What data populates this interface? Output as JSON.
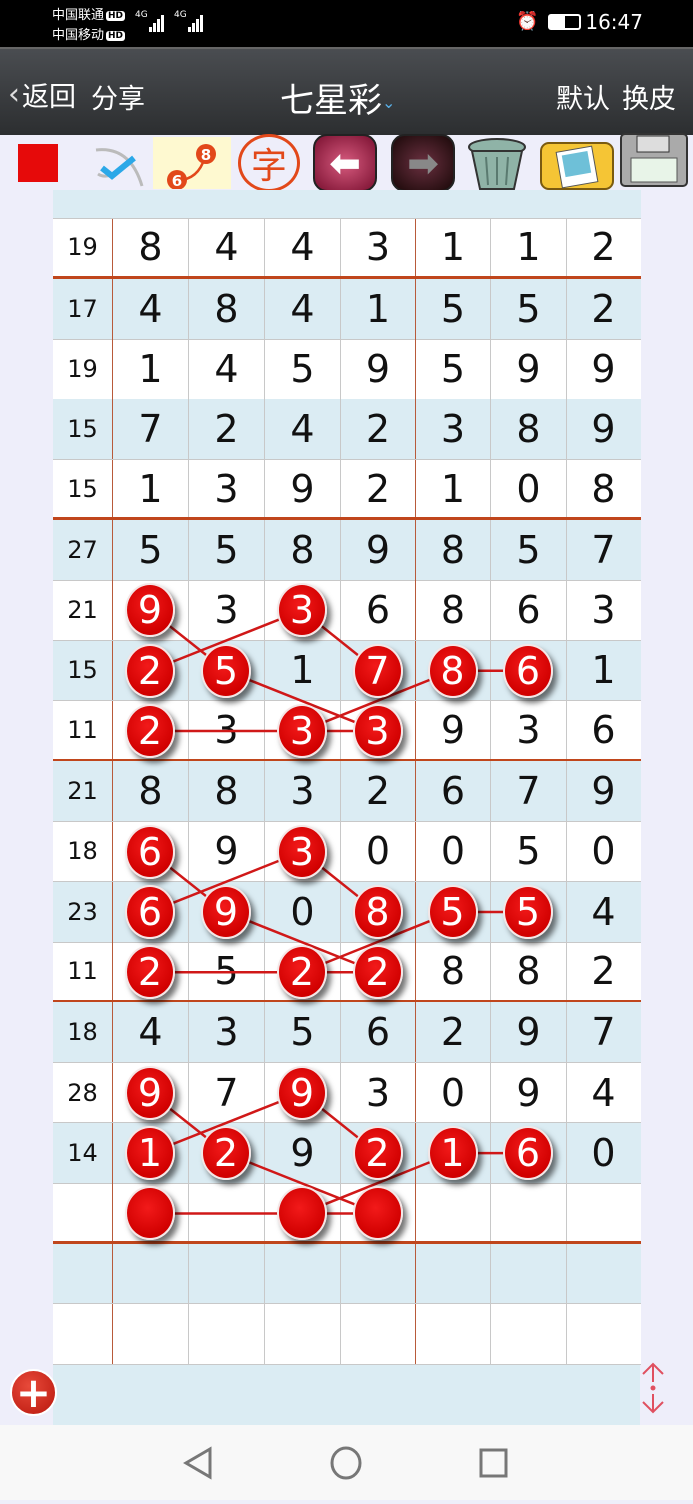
{
  "status_bar": {
    "carrier1": "中国联通",
    "carrier2": "中国移动",
    "hd": "HD",
    "net1": "4G",
    "net2": "4G",
    "time": "16:47",
    "battery_percent": 50
  },
  "header": {
    "back_label": "返回",
    "share_label": "分享",
    "title": "七星彩",
    "default_label": "默认",
    "skin_label": "换皮"
  },
  "toolbar": {
    "icons": [
      "red-square",
      "check-mark",
      "link-6-8",
      "zi-character",
      "arrow-left",
      "arrow-right",
      "trash",
      "photo-folder",
      "floppy-disk"
    ],
    "link_small": "6",
    "link_big": "8",
    "zi": "字",
    "selected_color": "#e60a0a"
  },
  "colors": {
    "ball": "#e00000",
    "row_alt": "#dbecf3",
    "group_line": "#c0461c"
  },
  "table": {
    "rows": [
      {
        "sum": "19",
        "nums": [
          "8",
          "4",
          "4",
          "3",
          "1",
          "1",
          "2"
        ]
      },
      {
        "sum": "17",
        "nums": [
          "4",
          "8",
          "4",
          "1",
          "5",
          "5",
          "2"
        ]
      },
      {
        "sum": "19",
        "nums": [
          "1",
          "4",
          "5",
          "9",
          "5",
          "9",
          "9"
        ]
      },
      {
        "sum": "15",
        "nums": [
          "7",
          "2",
          "4",
          "2",
          "3",
          "8",
          "9"
        ]
      },
      {
        "sum": "15",
        "nums": [
          "1",
          "3",
          "9",
          "2",
          "1",
          "0",
          "8"
        ]
      },
      {
        "sum": "27",
        "nums": [
          "5",
          "5",
          "8",
          "9",
          "8",
          "5",
          "7"
        ]
      },
      {
        "sum": "21",
        "nums": [
          "9",
          "3",
          "3",
          "6",
          "8",
          "6",
          "3"
        ],
        "balls": [
          0,
          2
        ]
      },
      {
        "sum": "15",
        "nums": [
          "2",
          "5",
          "1",
          "7",
          "8",
          "6",
          "1"
        ],
        "balls": [
          0,
          1,
          3,
          4,
          5
        ]
      },
      {
        "sum": "11",
        "nums": [
          "2",
          "3",
          "3",
          "3",
          "9",
          "3",
          "6"
        ],
        "balls": [
          0,
          2,
          3
        ]
      },
      {
        "sum": "21",
        "nums": [
          "8",
          "8",
          "3",
          "2",
          "6",
          "7",
          "9"
        ]
      },
      {
        "sum": "18",
        "nums": [
          "6",
          "9",
          "3",
          "0",
          "0",
          "5",
          "0"
        ],
        "balls": [
          0,
          2
        ]
      },
      {
        "sum": "23",
        "nums": [
          "6",
          "9",
          "0",
          "8",
          "5",
          "5",
          "4"
        ],
        "balls": [
          0,
          1,
          3,
          4,
          5
        ]
      },
      {
        "sum": "11",
        "nums": [
          "2",
          "5",
          "2",
          "2",
          "8",
          "8",
          "2"
        ],
        "balls": [
          0,
          2,
          3
        ]
      },
      {
        "sum": "18",
        "nums": [
          "4",
          "3",
          "5",
          "6",
          "2",
          "9",
          "7"
        ]
      },
      {
        "sum": "28",
        "nums": [
          "9",
          "7",
          "9",
          "3",
          "0",
          "9",
          "4"
        ],
        "balls": [
          0,
          2
        ]
      },
      {
        "sum": "14",
        "nums": [
          "1",
          "2",
          "9",
          "2",
          "1",
          "6",
          "0"
        ],
        "balls": [
          0,
          1,
          3,
          4,
          5
        ]
      },
      {
        "sum": "",
        "nums": [
          "",
          "",
          "",
          "",
          "",
          "",
          ""
        ],
        "balls": [
          0,
          2,
          3
        ]
      },
      {
        "sum": "",
        "nums": [
          "",
          "",
          "",
          "",
          "",
          "",
          ""
        ]
      },
      {
        "sum": "",
        "nums": [
          "",
          "",
          "",
          "",
          "",
          "",
          ""
        ]
      }
    ],
    "group_end_rows": [
      0,
      4,
      8,
      12,
      16
    ],
    "links": [
      [
        [
          6,
          0
        ],
        [
          7,
          1
        ]
      ],
      [
        [
          7,
          0
        ],
        [
          6,
          2
        ]
      ],
      [
        [
          6,
          2
        ],
        [
          7,
          3
        ]
      ],
      [
        [
          7,
          1
        ],
        [
          8,
          3
        ]
      ],
      [
        [
          8,
          0
        ],
        [
          8,
          2
        ]
      ],
      [
        [
          8,
          2
        ],
        [
          8,
          3
        ]
      ],
      [
        [
          8,
          2
        ],
        [
          7,
          4
        ]
      ],
      [
        [
          7,
          4
        ],
        [
          7,
          5
        ]
      ],
      [
        [
          10,
          0
        ],
        [
          11,
          1
        ]
      ],
      [
        [
          11,
          0
        ],
        [
          10,
          2
        ]
      ],
      [
        [
          10,
          2
        ],
        [
          11,
          3
        ]
      ],
      [
        [
          11,
          1
        ],
        [
          12,
          3
        ]
      ],
      [
        [
          12,
          0
        ],
        [
          12,
          2
        ]
      ],
      [
        [
          12,
          2
        ],
        [
          12,
          3
        ]
      ],
      [
        [
          12,
          2
        ],
        [
          11,
          4
        ]
      ],
      [
        [
          11,
          4
        ],
        [
          11,
          5
        ]
      ],
      [
        [
          14,
          0
        ],
        [
          15,
          1
        ]
      ],
      [
        [
          15,
          0
        ],
        [
          14,
          2
        ]
      ],
      [
        [
          14,
          2
        ],
        [
          15,
          3
        ]
      ],
      [
        [
          15,
          1
        ],
        [
          16,
          3
        ]
      ],
      [
        [
          16,
          0
        ],
        [
          16,
          2
        ]
      ],
      [
        [
          16,
          2
        ],
        [
          16,
          3
        ]
      ],
      [
        [
          16,
          2
        ],
        [
          15,
          4
        ]
      ],
      [
        [
          15,
          4
        ],
        [
          15,
          5
        ]
      ]
    ]
  },
  "footer": {
    "add_icon": "plus-icon",
    "scroll_icon": "up-down-arrows-icon"
  },
  "nav_bar": {
    "icons": [
      "back-triangle",
      "home-circle",
      "recents-square"
    ]
  }
}
